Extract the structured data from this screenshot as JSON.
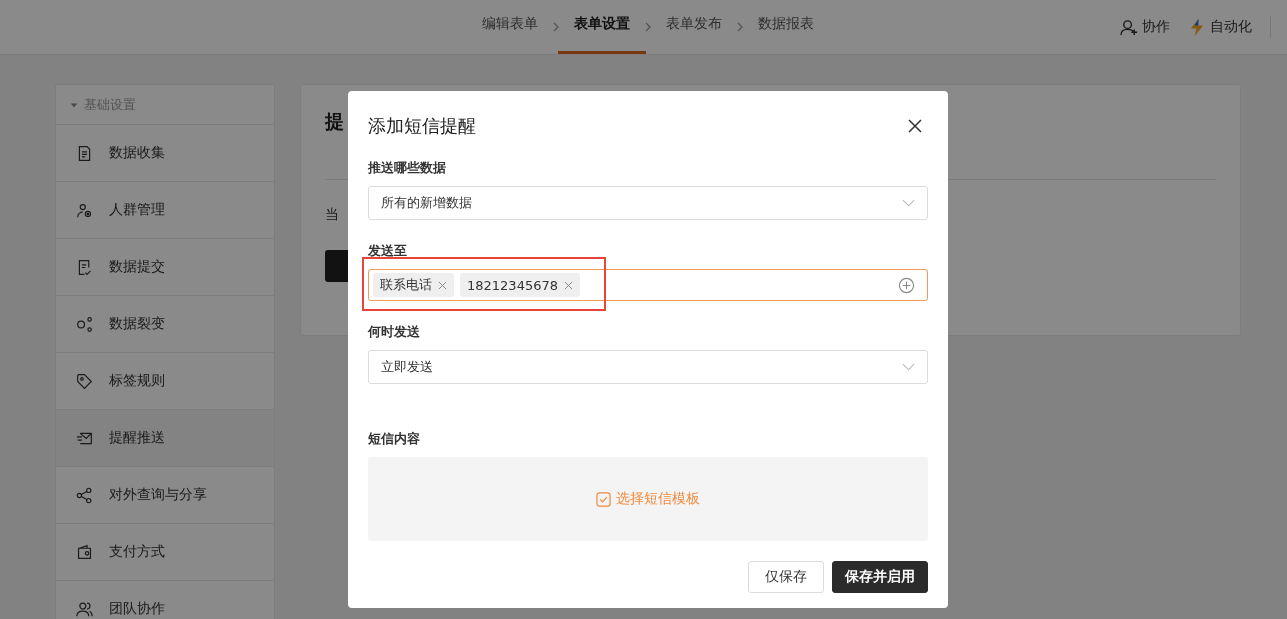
{
  "steps": [
    {
      "label": "编辑表单",
      "selected": false
    },
    {
      "label": "表单设置",
      "selected": true
    },
    {
      "label": "表单发布",
      "selected": false
    },
    {
      "label": "数据报表",
      "selected": false
    }
  ],
  "header_actions": [
    {
      "label": "协作"
    },
    {
      "label": "自动化"
    }
  ],
  "sidebar": {
    "group": "基础设置",
    "expanded": true,
    "items": [
      {
        "label": "数据收集",
        "selected": false
      },
      {
        "label": "人群管理",
        "selected": false
      },
      {
        "label": "数据提交",
        "selected": false
      },
      {
        "label": "数据裂变",
        "selected": false
      },
      {
        "label": "标签规则",
        "selected": false
      },
      {
        "label": "提醒推送",
        "selected": true
      },
      {
        "label": "对外查询与分享",
        "selected": false
      },
      {
        "label": "支付方式",
        "selected": false
      },
      {
        "label": "团队协作",
        "selected": false
      }
    ]
  },
  "panel": {
    "title": "提",
    "text": "当"
  },
  "dialog": {
    "title": "添加短信提醒",
    "push_data": {
      "label": "推送哪些数据",
      "value": "所有的新增数据"
    },
    "send_to": {
      "label": "发送至",
      "tags": [
        "联系电话",
        "18212345678"
      ],
      "highlighted": true
    },
    "when": {
      "label": "何时发送",
      "value": "立即发送"
    },
    "content": {
      "label": "短信内容",
      "action": "选择短信模板"
    },
    "buttons": [
      {
        "kind": "secondary",
        "label": "仅保存"
      },
      {
        "kind": "primary",
        "label": "保存并启用"
      }
    ]
  }
}
